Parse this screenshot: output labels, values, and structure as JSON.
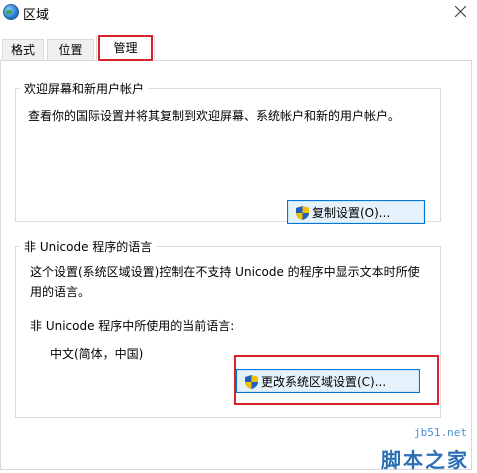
{
  "window": {
    "title": "区域"
  },
  "tabs": [
    {
      "label": "格式"
    },
    {
      "label": "位置"
    },
    {
      "label": "管理",
      "active": true
    }
  ],
  "welcome_group": {
    "title": "欢迎屏幕和新用户帐户",
    "description": "查看你的国际设置并将其复制到欢迎屏幕、系统帐户和新的用户帐户。",
    "button_label": "复制设置(O)..."
  },
  "unicode_group": {
    "title": "非 Unicode 程序的语言",
    "description": "这个设置(系统区域设置)控制在不支持 Unicode 的程序中显示文本时所使用的语言。",
    "current_label": "非 Unicode 程序中所使用的当前语言:",
    "current_value": "中文(简体，中国)",
    "button_label": "更改系统区域设置(C)..."
  },
  "icons": {
    "app": "globe-icon",
    "close": "close-icon",
    "shield": "uac-shield-icon"
  },
  "watermark": {
    "url": "jb51.net",
    "text": "脚本之家"
  },
  "colors": {
    "highlight": "#d9232a",
    "button_border": "#0078d7",
    "button_bg": "#e5f1fb"
  }
}
